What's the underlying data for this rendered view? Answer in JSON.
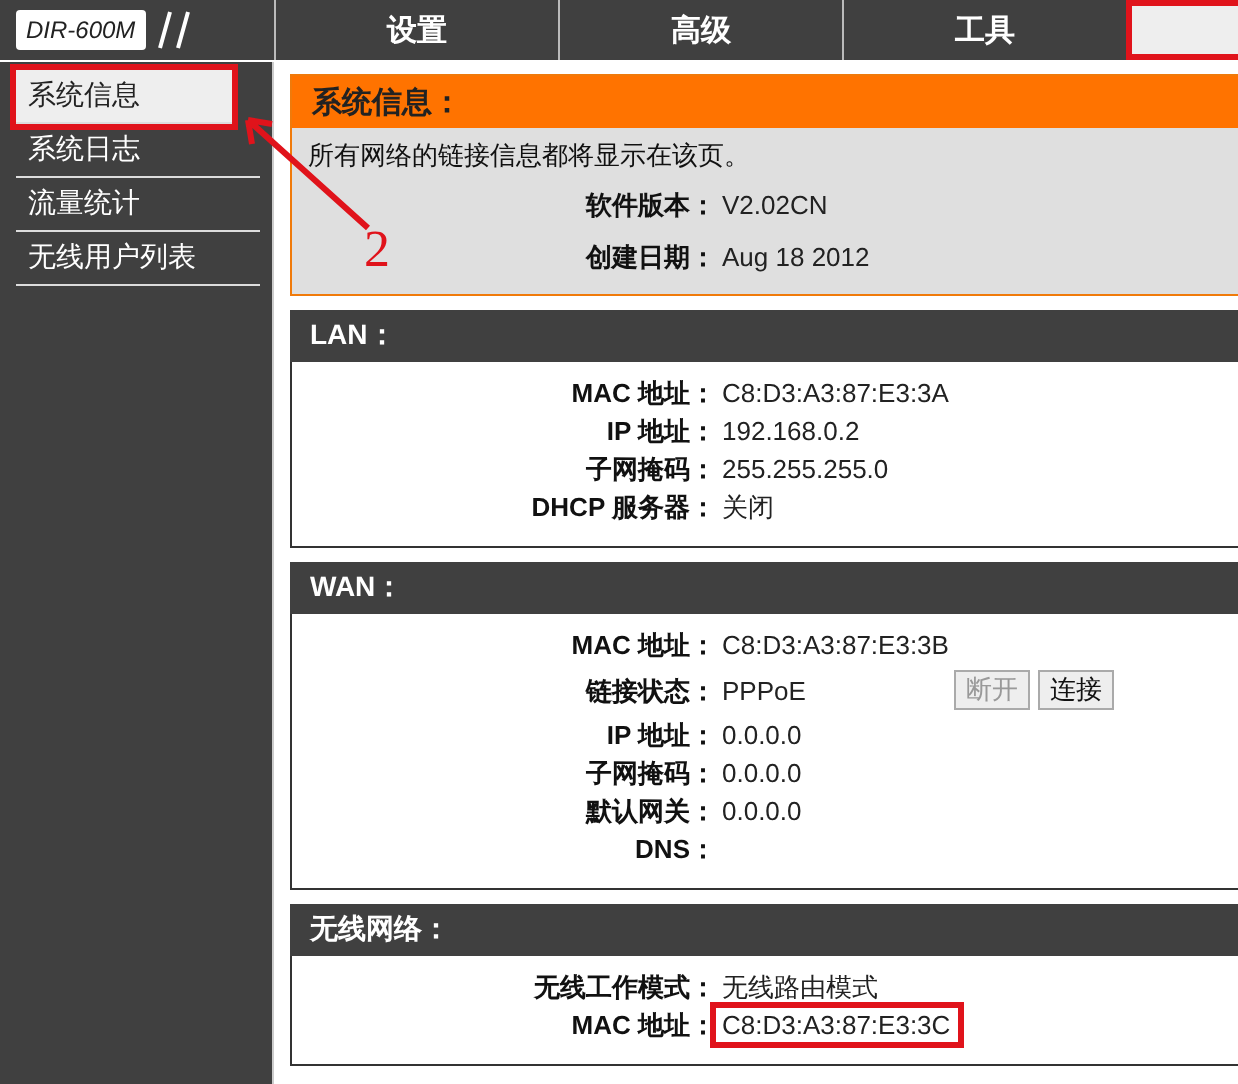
{
  "logo": "DIR-600M",
  "tabs": [
    {
      "label": "设置",
      "selected": false,
      "highlighted": false
    },
    {
      "label": "高级",
      "selected": false,
      "highlighted": false
    },
    {
      "label": "工具",
      "selected": false,
      "highlighted": false
    },
    {
      "selected": true,
      "highlighted": true
    }
  ],
  "sidebar": {
    "items": [
      {
        "label": "系统信息",
        "selected": true,
        "highlighted": true
      },
      {
        "label": "系统日志",
        "selected": false,
        "highlighted": false
      },
      {
        "label": "流量统计",
        "selected": false,
        "highlighted": false
      },
      {
        "label": "无线用户列表",
        "selected": false,
        "highlighted": false
      }
    ]
  },
  "annotation": {
    "label": "2"
  },
  "info": {
    "title": "系统信息：",
    "description": "所有网络的链接信息都将显示在该页。",
    "rows": [
      {
        "label": "软件版本：",
        "value": "V2.02CN"
      },
      {
        "label": "创建日期：",
        "value": "Aug 18 2012"
      }
    ]
  },
  "sections": [
    {
      "title": "LAN：",
      "rows": [
        {
          "label": "MAC 地址：",
          "value": "C8:D3:A3:87:E3:3A"
        },
        {
          "label": "IP 地址：",
          "value": "192.168.0.2"
        },
        {
          "label": "子网掩码：",
          "value": "255.255.255.0"
        },
        {
          "label": "DHCP 服务器：",
          "value": "关闭"
        }
      ]
    },
    {
      "title": "WAN：",
      "rows": [
        {
          "label": "MAC 地址：",
          "value": "C8:D3:A3:87:E3:3B"
        },
        {
          "label": "链接状态：",
          "value": "PPPoE",
          "buttons": [
            {
              "label": "断开",
              "disabled": true
            },
            {
              "label": "连接",
              "disabled": false
            }
          ]
        },
        {
          "label": "IP 地址：",
          "value": "0.0.0.0"
        },
        {
          "label": "子网掩码：",
          "value": "0.0.0.0"
        },
        {
          "label": "默认网关：",
          "value": "0.0.0.0"
        },
        {
          "label": "DNS："
        }
      ]
    },
    {
      "title": "无线网络：",
      "rows": [
        {
          "label": "无线工作模式：",
          "value": "无线路由模式"
        },
        {
          "label": "MAC 地址：",
          "value": "C8:D3:A3:87:E3:3C",
          "highlighted": true
        }
      ]
    }
  ]
}
